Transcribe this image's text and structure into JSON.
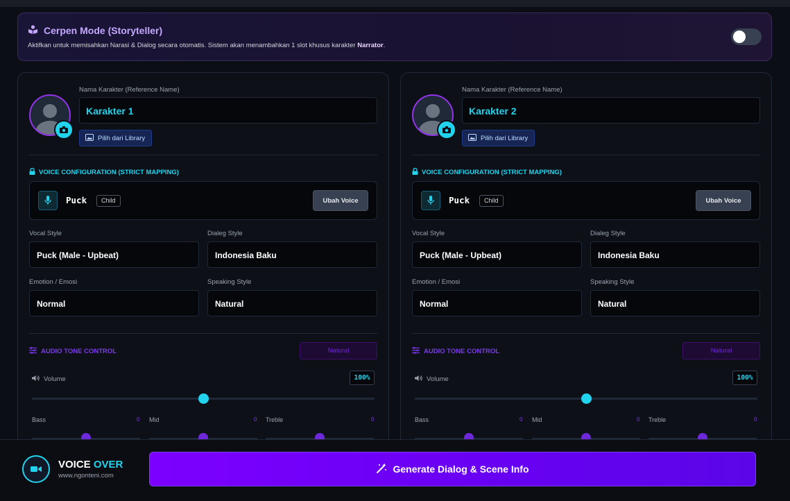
{
  "banner": {
    "title": "Cerpen Mode (Storyteller)",
    "desc_prefix": "Aktifkan untuk memisahkan Narasi & Dialog secara otomatis. Sistem akan menambahkan 1 slot khusus karakter ",
    "desc_bold": "Narrator",
    "desc_suffix": ".",
    "toggle_on": false
  },
  "cards": [
    {
      "name_label": "Nama Karakter (Reference Name)",
      "name_value": "Karakter 1",
      "library_button": "Pilih dari Library",
      "voice_config_title": "VOICE CONFIGURATION (STRICT MAPPING)",
      "voice_name": "Puck",
      "voice_badge": "Child",
      "change_voice_button": "Ubah Voice",
      "vocal_style_label": "Vocal Style",
      "vocal_style_value": "Puck (Male - Upbeat)",
      "dialect_label": "Dialeg Style",
      "dialect_value": "Indonesia Baku",
      "emotion_label": "Emotion / Emosi",
      "emotion_value": "Normal",
      "speaking_label": "Speaking Style",
      "speaking_value": "Natural",
      "tone_title": "AUDIO TONE CONTROL",
      "tone_preset": "Natural",
      "volume_label": "Volume",
      "volume_value": "100%",
      "volume_fraction": 0.5,
      "bass_label": "Bass",
      "bass_value": "0",
      "bass_fraction": 0.5,
      "mid_label": "Mid",
      "mid_value": "0",
      "mid_fraction": 0.5,
      "treble_label": "Treble",
      "treble_value": "0",
      "treble_fraction": 0.5
    },
    {
      "name_label": "Nama Karakter (Reference Name)",
      "name_value": "Karakter 2",
      "library_button": "Pilih dari Library",
      "voice_config_title": "VOICE CONFIGURATION (STRICT MAPPING)",
      "voice_name": "Puck",
      "voice_badge": "Child",
      "change_voice_button": "Ubah Voice",
      "vocal_style_label": "Vocal Style",
      "vocal_style_value": "Puck (Male - Upbeat)",
      "dialect_label": "Dialeg Style",
      "dialect_value": "Indonesia Baku",
      "emotion_label": "Emotion / Emosi",
      "emotion_value": "Normal",
      "speaking_label": "Speaking Style",
      "speaking_value": "Natural",
      "tone_title": "AUDIO TONE CONTROL",
      "tone_preset": "Natural",
      "volume_label": "Volume",
      "volume_value": "100%",
      "volume_fraction": 0.5,
      "bass_label": "Bass",
      "bass_value": "0",
      "bass_fraction": 0.5,
      "mid_label": "Mid",
      "mid_value": "0",
      "mid_fraction": 0.5,
      "treble_label": "Treble",
      "treble_value": "0",
      "treble_fraction": 0.5
    }
  ],
  "footer": {
    "brand_word1": "VOICE",
    "brand_word2": "OVER",
    "brand_url": "www.ngonteni.com",
    "generate_button": "Generate Dialog & Scene Info"
  },
  "colors": {
    "accent_cyan": "#22d3ee",
    "accent_purple": "#7c3aed",
    "generate_gradient_start": "#7c00ff"
  }
}
